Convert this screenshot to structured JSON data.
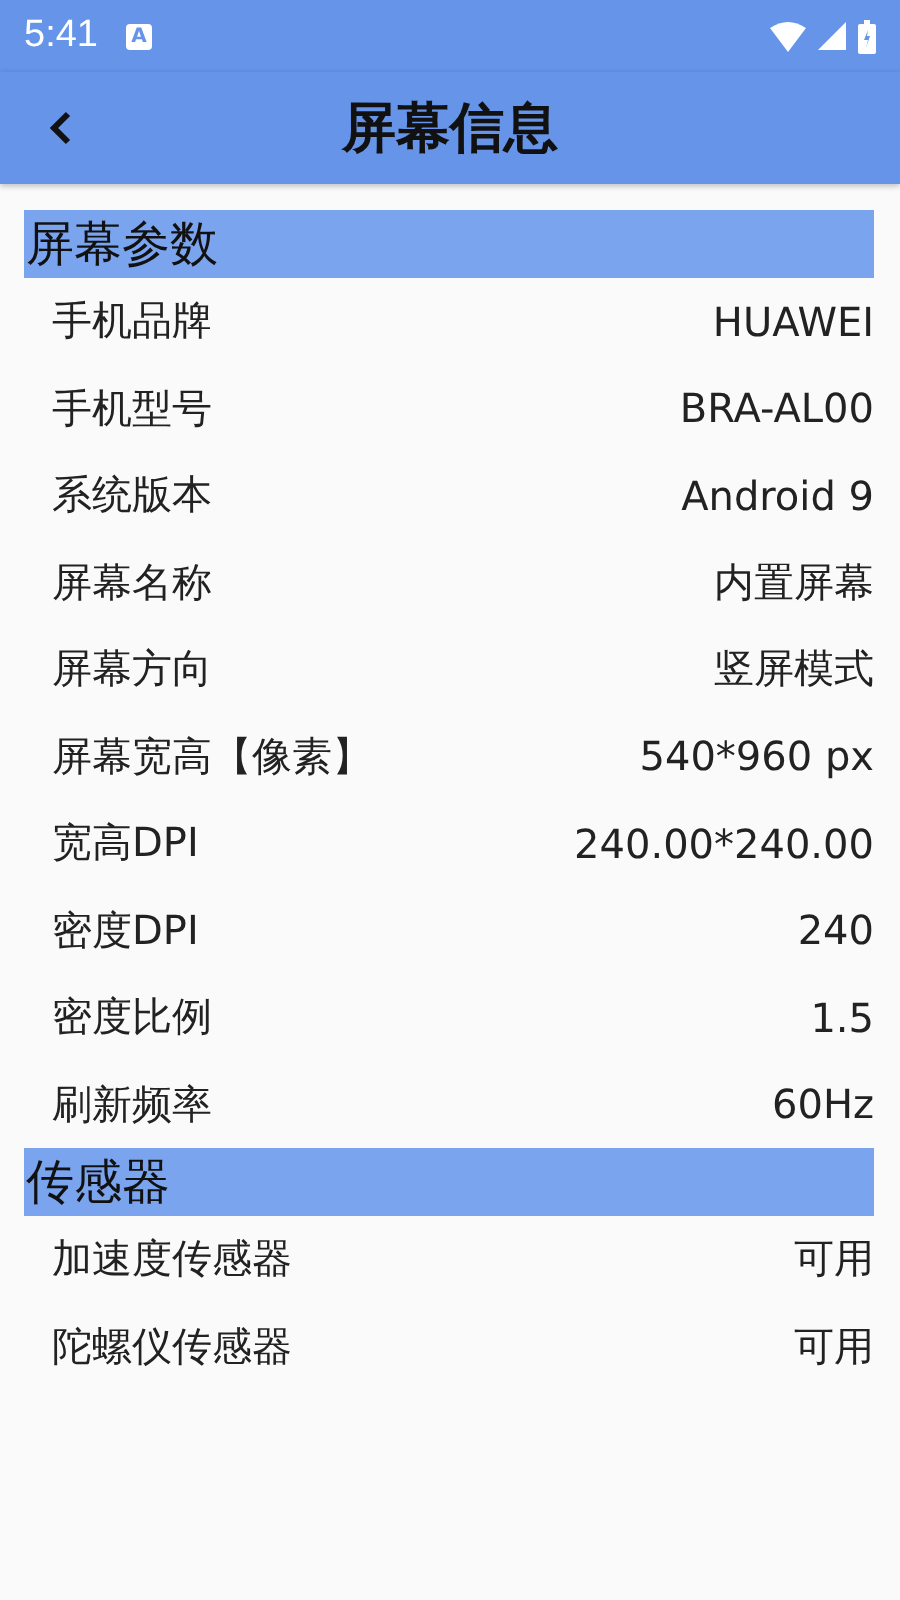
{
  "status_bar": {
    "time": "5:41",
    "notification": "A"
  },
  "app_bar": {
    "title": "屏幕信息"
  },
  "sections": [
    {
      "title": "屏幕参数",
      "rows": [
        {
          "label": "手机品牌",
          "value": "HUAWEI"
        },
        {
          "label": "手机型号",
          "value": "BRA-AL00"
        },
        {
          "label": "系统版本",
          "value": "Android 9"
        },
        {
          "label": "屏幕名称",
          "value": "内置屏幕"
        },
        {
          "label": "屏幕方向",
          "value": "竖屏模式"
        },
        {
          "label": "屏幕宽高【像素】",
          "value": "540*960 px"
        },
        {
          "label": "宽高DPI",
          "value": "240.00*240.00"
        },
        {
          "label": "密度DPI",
          "value": "240"
        },
        {
          "label": "密度比例",
          "value": "1.5"
        },
        {
          "label": "刷新频率",
          "value": "60Hz"
        }
      ]
    },
    {
      "title": "传感器",
      "rows": [
        {
          "label": "加速度传感器",
          "value": "可用"
        },
        {
          "label": "陀螺仪传感器",
          "value": "可用"
        }
      ]
    }
  ]
}
